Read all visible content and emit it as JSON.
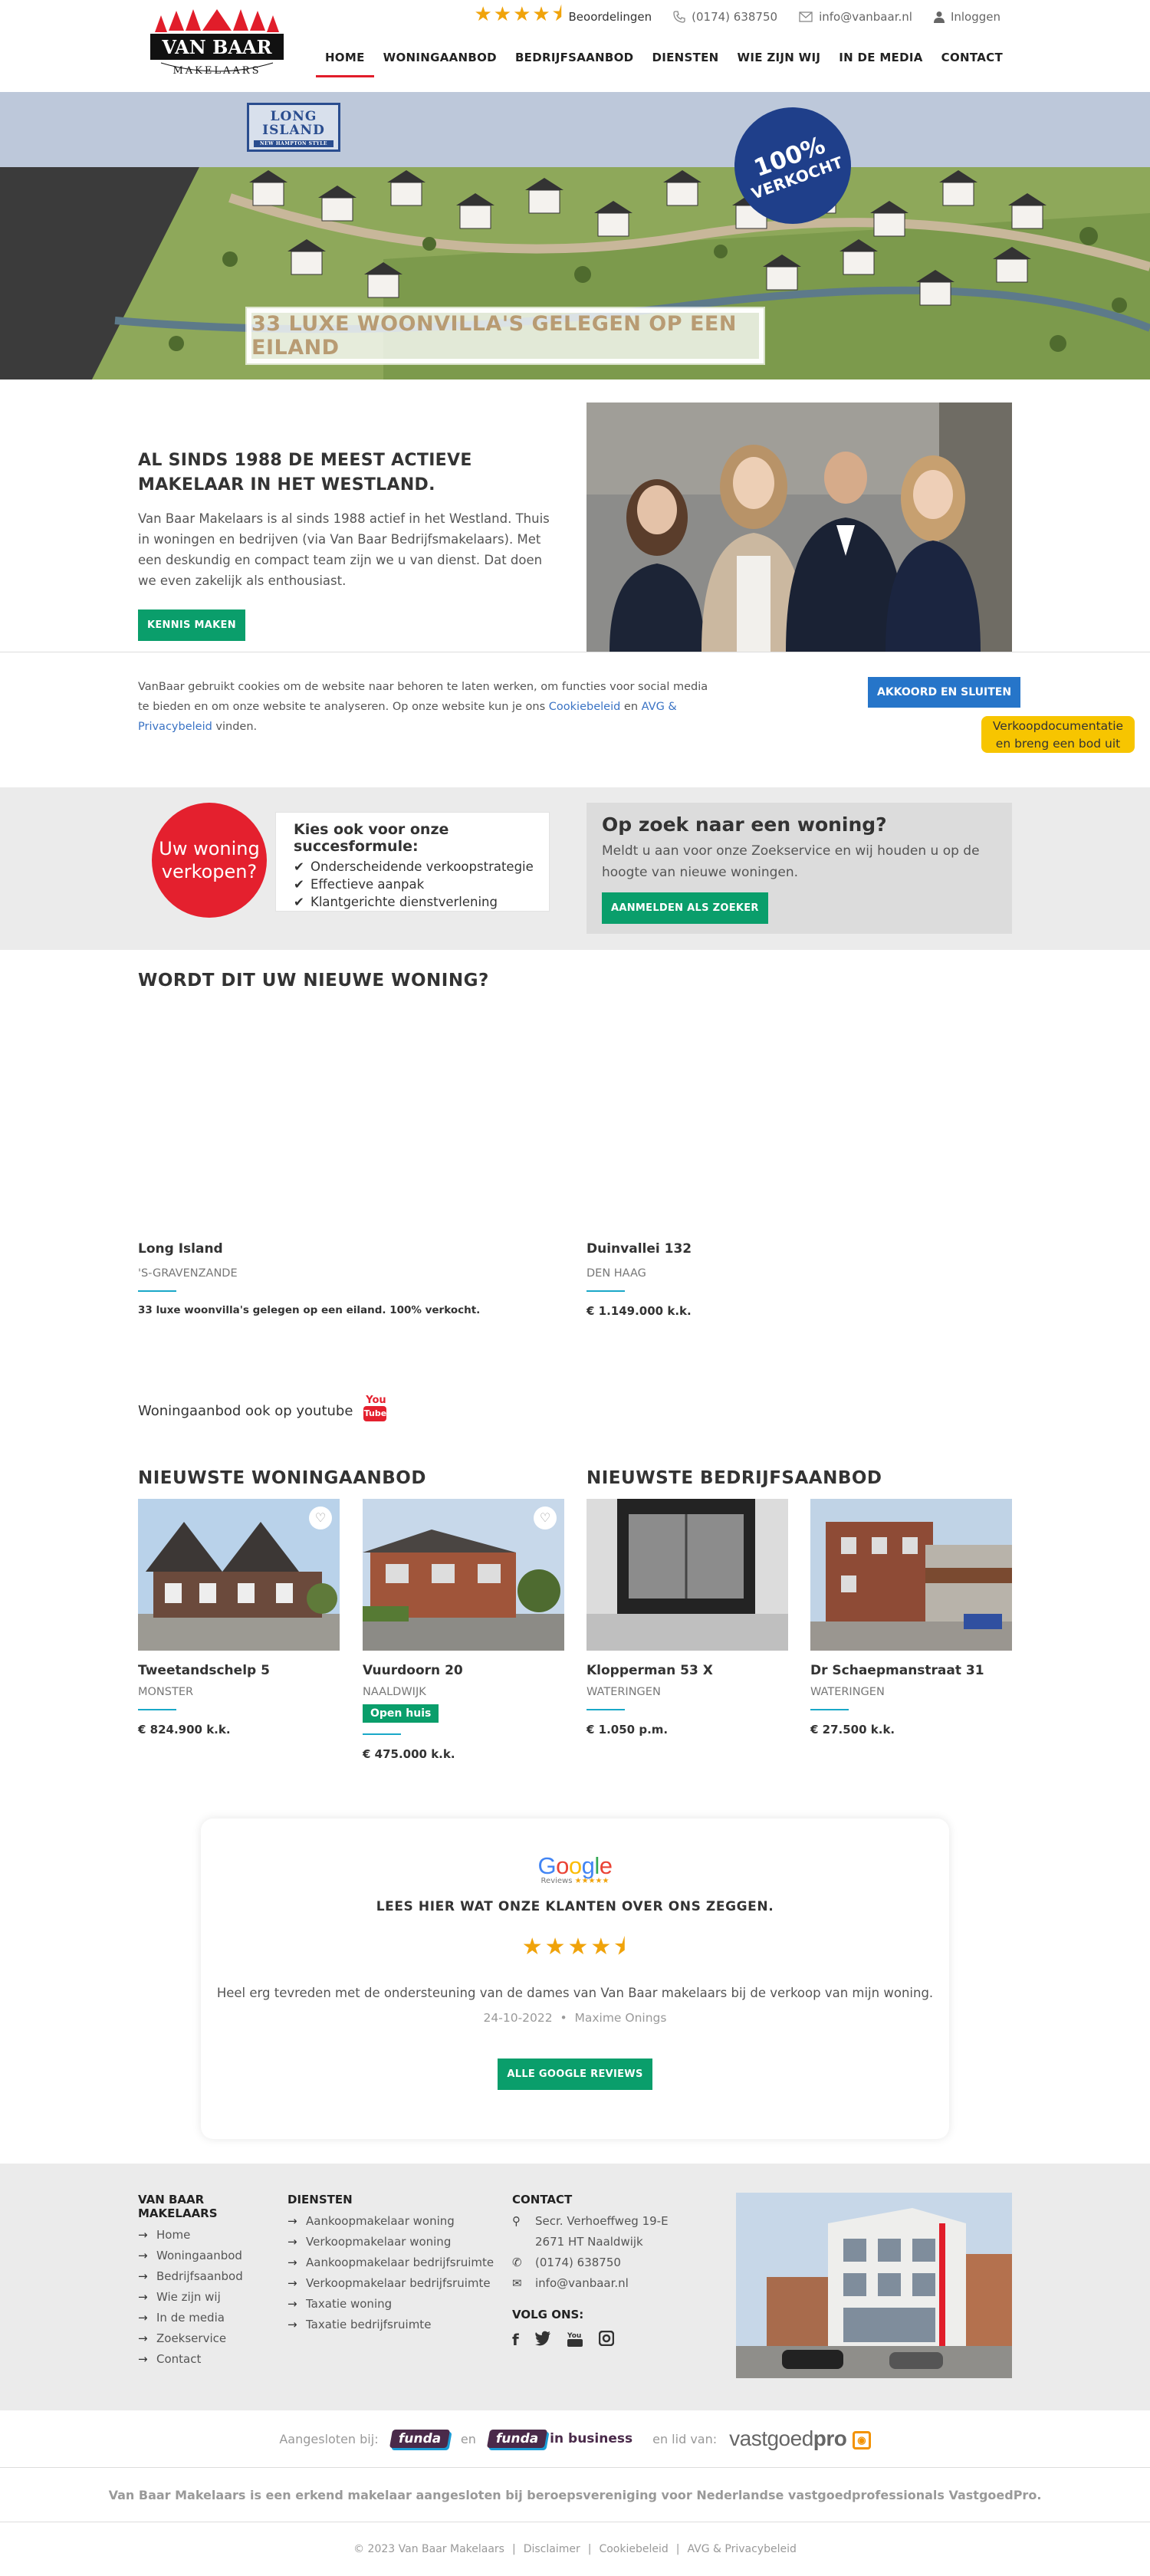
{
  "header": {
    "logo_text_top": "VAN BAAR",
    "logo_text_bottom": "MAKELAARS",
    "rating_stars": "★★★★⯨",
    "rating_label": "Beoordelingen",
    "phone": "(0174) 638750",
    "email": "info@vanbaar.nl",
    "login": "Inloggen",
    "nav": [
      "HOME",
      "WONINGAANBOD",
      "BEDRIJFSAANBOD",
      "DIENSTEN",
      "WIE ZIJN WIJ",
      "IN DE MEDIA",
      "CONTACT"
    ],
    "active_nav": "HOME"
  },
  "hero": {
    "project_logo_line1": "LONG",
    "project_logo_line2": "ISLAND",
    "project_logo_line3": "NEW HAMPTON STYLE",
    "badge_line1": "100%",
    "badge_line2": "VERKOCHT",
    "caption": "33 LUXE WOONVILLA'S GELEGEN OP EEN EILAND"
  },
  "intro": {
    "title": "AL SINDS 1988 DE MEEST ACTIEVE MAKELAAR IN HET WESTLAND.",
    "body": "Van Baar Makelaars is al sinds 1988 actief in het Westland. Thuis in woningen en bedrijven (via Van Baar Bedrijfsmakelaars). Met een deskundig en compact team zijn we u van dienst. Dat doen we even zakelijk als enthousiast.",
    "button": "KENNIS MAKEN"
  },
  "cookie": {
    "text_before": "VanBaar gebruikt cookies om de website naar behoren te laten werken, om functies voor social media te bieden en om onze website te analyseren. Op onze website kun je ons ",
    "link1": "Cookiebeleid",
    "text_mid": " en ",
    "link2": "AVG & Privacybeleid",
    "text_after": " vinden.",
    "button": "AKKOORD EN SLUITEN"
  },
  "doc_tab": {
    "line1": "Verkoopdocumentatie",
    "line2": "en breng een bod uit"
  },
  "succes": {
    "circle_line1": "Uw woning",
    "circle_line2": "verkopen?",
    "title": "Kies ook voor onze succesformule:",
    "items": [
      "Onderscheidende verkoopstrategie",
      "Effectieve aanpak",
      "Klantgerichte dienstverlening"
    ],
    "search_title": "Op zoek naar een woning?",
    "search_body": "Meldt u aan voor onze Zoekservice en wij houden u op de hoogte van nieuwe woningen.",
    "search_button": "AANMELDEN ALS ZOEKER"
  },
  "featured": {
    "title": "WORDT DIT UW NIEUWE WONING?",
    "cards": [
      {
        "name": "Long Island",
        "place": "'S-GRAVENZANDE",
        "price": "33 luxe woonvilla's gelegen op een eiland. 100% verkocht."
      },
      {
        "name": "Duinvallei 132",
        "place": "DEN HAAG",
        "price": "€ 1.149.000 k.k."
      }
    ]
  },
  "youtube": {
    "label": "Woningaanbod ook op youtube",
    "logo_top": "You",
    "logo_bottom": "Tube"
  },
  "listings": {
    "woning_title": "NIEUWSTE WONINGAANBOD",
    "bedrijf_title": "NIEUWSTE BEDRIJFSAANBOD",
    "cards": [
      {
        "name": "Tweetandschelp 5",
        "place": "MONSTER",
        "badge": "",
        "price": "€ 824.900 k.k."
      },
      {
        "name": "Vuurdoorn 20",
        "place": "NAALDWIJK",
        "badge": "Open huis",
        "price": "€ 475.000 k.k."
      },
      {
        "name": "Klopperman 53 X",
        "place": "WATERINGEN",
        "badge": "",
        "price": "€ 1.050 p.m."
      },
      {
        "name": "Dr Schaepmanstraat 31",
        "place": "WATERINGEN",
        "badge": "",
        "price": "€ 27.500 k.k."
      }
    ]
  },
  "reviews": {
    "google": "Google",
    "google_sub": "Reviews",
    "google_sub_stars": "★★★★★",
    "title": "LEES HIER WAT ONZE KLANTEN OVER ONS ZEGGEN.",
    "stars": "★★★★⯨",
    "text": "Heel erg tevreden met de ondersteuning van de dames van Van Baar makelaars bij de verkoop van mijn woning.",
    "date": "24-10-2022",
    "author": "Maxime Onings",
    "button": "ALLE GOOGLE REVIEWS"
  },
  "footer": {
    "col1_title": "VAN BAAR MAKELAARS",
    "col1_items": [
      "Home",
      "Woningaanbod",
      "Bedrijfsaanbod",
      "Wie zijn wij",
      "In de media",
      "Zoekservice",
      "Contact"
    ],
    "col2_title": "DIENSTEN",
    "col2_items": [
      "Aankoopmakelaar woning",
      "Verkoopmakelaar woning",
      "Aankoopmakelaar bedrijfsruimte",
      "Verkoopmakelaar bedrijfsruimte",
      "Taxatie woning",
      "Taxatie bedrijfsruimte"
    ],
    "contact_title": "CONTACT",
    "address1": "Secr. Verhoeffweg 19-E",
    "address2": "2671 HT Naaldwijk",
    "phone": "(0174) 638750",
    "email": "info@vanbaar.nl",
    "follow": "VOLG ONS:"
  },
  "partners": {
    "aangesloten": "Aangesloten bij:",
    "funda": "funda",
    "en": "en",
    "funda2": "funda",
    "inbusiness": "in business",
    "lid": "en lid van:",
    "vgp_light": "vastgoed",
    "vgp_bold": "pro"
  },
  "disclaimer": "Van Baar Makelaars is een erkend makelaar aangesloten bij beroepsvereniging voor Nederlandse vastgoedprofessionals VastgoedPro.",
  "copyright": {
    "text": "© 2023 Van Baar Makelaars",
    "links": [
      "Disclaimer",
      "Cookiebeleid",
      "AVG & Privacybeleid"
    ]
  },
  "colors": {
    "accent_red": "#e11d2a",
    "green_button": "#0a9e6b",
    "blue_button": "#2675c9",
    "star": "#f0a30a",
    "doc_tab": "#f7c500"
  }
}
